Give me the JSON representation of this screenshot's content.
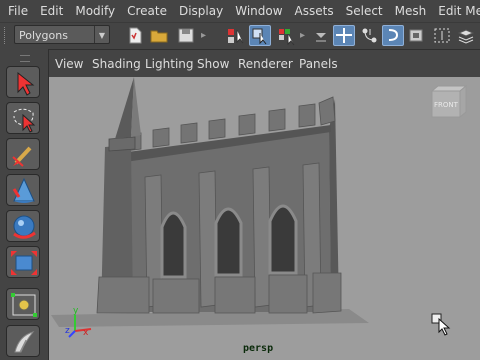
{
  "menubar": {
    "items": [
      "File",
      "Edit",
      "Modify",
      "Create",
      "Display",
      "Window",
      "Assets",
      "Select",
      "Mesh",
      "Edit Mesh"
    ]
  },
  "toolbar": {
    "mode_menu": {
      "selected": "Polygons"
    }
  },
  "viewport_menu": {
    "items": [
      "View",
      "Shading",
      "Lighting",
      "Show",
      "Renderer",
      "Panels"
    ]
  },
  "viewport": {
    "camera_label": "persp",
    "view_cube_label": "FRONT",
    "axis_labels": [
      "y",
      "z",
      "x"
    ]
  },
  "colors": {
    "ui_background": "#444444",
    "viewport_background": "#9d9d9d",
    "highlight": "#5b85b5",
    "model_gray": "#6a6a6a"
  }
}
